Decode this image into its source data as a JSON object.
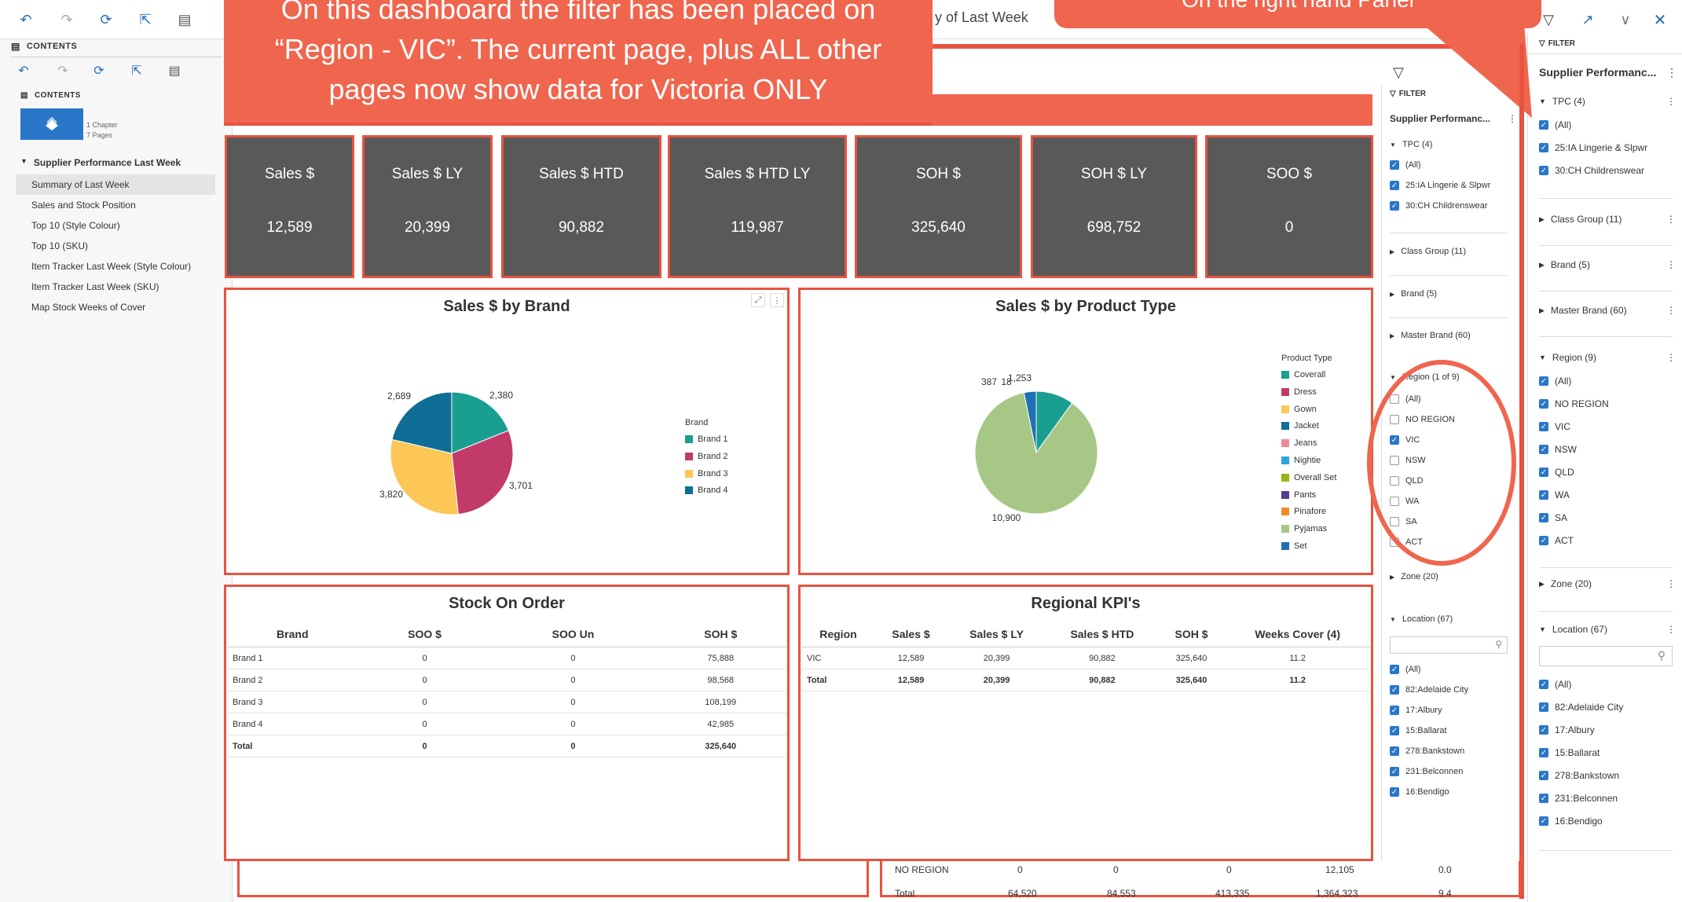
{
  "toolbar": {
    "doc_title": "y of Last Week"
  },
  "contents": {
    "header": "CONTENTS",
    "inner_header": "CONTENTS",
    "chapter_count": "1 Chapter",
    "page_count": "7 Pages",
    "chapter": "Supplier Performance Last Week",
    "pages": [
      "Summary of Last Week",
      "Sales and Stock Position",
      "Top 10 (Style Colour)",
      "Top 10 (SKU)",
      "Item Tracker Last Week (Style Colour)",
      "Item Tracker Last Week (SKU)",
      "Map Stock Weeks of Cover"
    ]
  },
  "callout_left": {
    "lines": [
      "On this dashboard the filter has been placed on",
      "“Region - VIC”. The current page, plus ALL other",
      "pages now show data for Victoria ONLY"
    ]
  },
  "callout_right": {
    "text": "On the right hand Panel"
  },
  "kpis": [
    {
      "title": "Sales $",
      "value": "12,589"
    },
    {
      "title": "Sales $ LY",
      "value": "20,399"
    },
    {
      "title": "Sales $ HTD",
      "value": "90,882"
    },
    {
      "title": "Sales $ HTD LY",
      "value": "119,987"
    },
    {
      "title": "SOH $",
      "value": "325,640"
    },
    {
      "title": "SOH $ LY",
      "value": "698,752"
    },
    {
      "title": "SOO $",
      "value": "0"
    }
  ],
  "chart_data": [
    {
      "type": "pie",
      "title": "Sales $ by Brand",
      "legend_title": "Brand",
      "categories": [
        "Brand 1",
        "Brand 2",
        "Brand 3",
        "Brand 4"
      ],
      "values": [
        2380,
        3701,
        3820,
        2689
      ],
      "colors": [
        "#1a9e8f",
        "#c23a6a",
        "#fcc757",
        "#0f6e96"
      ],
      "legend_position": "right"
    },
    {
      "type": "pie",
      "title": "Sales $ by Product Type",
      "legend_title": "Product Type",
      "categories": [
        "Coverall",
        "Dress",
        "Gown",
        "Jacket",
        "Jeans",
        "Nightie",
        "Overall Set",
        "Pants",
        "Pinafore",
        "Pyjamas",
        "Set"
      ],
      "colors": [
        "#1a9e8f",
        "#c23a6a",
        "#fcc757",
        "#0f6e96",
        "#ee8a9a",
        "#2aa6dd",
        "#99b514",
        "#563d8c",
        "#f08c2a",
        "#a6c785",
        "#1f6fb5"
      ],
      "values": [
        1253,
        0,
        0,
        0,
        0,
        0,
        0,
        0,
        0,
        10900,
        405
      ],
      "slice_labels": [
        "1,253",
        "18",
        "387",
        "10,900"
      ],
      "legend_position": "right"
    }
  ],
  "stock_table": {
    "title": "Stock On Order",
    "headers": [
      "Brand",
      "SOO $",
      "SOO Un",
      "SOH $"
    ],
    "rows": [
      [
        "Brand 1",
        "0",
        "0",
        "75,888"
      ],
      [
        "Brand 2",
        "0",
        "0",
        "98,568"
      ],
      [
        "Brand 3",
        "0",
        "0",
        "108,199"
      ],
      [
        "Brand 4",
        "0",
        "0",
        "42,985"
      ]
    ],
    "total": [
      "Total",
      "0",
      "0",
      "325,640"
    ]
  },
  "kpi_table": {
    "title": "Regional KPI's",
    "headers": [
      "Region",
      "Sales $",
      "Sales $ LY",
      "Sales $ HTD",
      "SOH $",
      "Weeks Cover (4)"
    ],
    "rows": [
      [
        "VIC",
        "12,589",
        "20,399",
        "90,882",
        "325,640",
        "11.2"
      ]
    ],
    "total": [
      "Total",
      "12,589",
      "20,399",
      "90,882",
      "325,640",
      "11.2"
    ]
  },
  "behind_table": {
    "row1": [
      "NO REGION",
      "0",
      "0",
      "0",
      "12,105",
      "0.0"
    ],
    "row2": [
      "Total",
      "64,520",
      "84,553",
      "413,335",
      "1,364,323",
      "9.4"
    ]
  },
  "filter_mid": {
    "header": "FILTER",
    "title": "Supplier Performanc...",
    "tpc": "TPC (4)",
    "tpc_items": [
      "(All)",
      "25:IA Lingerie & Slpwr",
      "30:CH Childrenswear"
    ],
    "class_group": "Class Group (11)",
    "brand": "Brand (5)",
    "master_brand": "Master Brand (60)",
    "region": "Region (1 of 9)",
    "region_items": [
      "(All)",
      "NO REGION",
      "VIC",
      "NSW",
      "QLD",
      "WA",
      "SA",
      "ACT"
    ],
    "zone": "Zone (20)",
    "location": "Location (67)",
    "location_items": [
      "(All)",
      "82:Adelaide City",
      "17:Albury",
      "15:Ballarat",
      "278:Bankstown",
      "231:Belconnen",
      "16:Bendigo"
    ]
  },
  "filter_right": {
    "header": "FILTER",
    "title": "Supplier Performanc...",
    "tpc": "TPC (4)",
    "tpc_items": [
      "(All)",
      "25:IA Lingerie & Slpwr",
      "30:CH Childrenswear"
    ],
    "class_group": "Class Group (11)",
    "brand": "Brand (5)",
    "master_brand": "Master Brand (60)",
    "region": "Region (9)",
    "region_items": [
      "(All)",
      "NO REGION",
      "VIC",
      "NSW",
      "QLD",
      "WA",
      "SA",
      "ACT"
    ],
    "zone": "Zone (20)",
    "location": "Location (67)",
    "location_items": [
      "(All)",
      "82:Adelaide City",
      "17:Albury",
      "15:Ballarat",
      "278:Bankstown",
      "231:Belconnen",
      "16:Bendigo"
    ]
  }
}
